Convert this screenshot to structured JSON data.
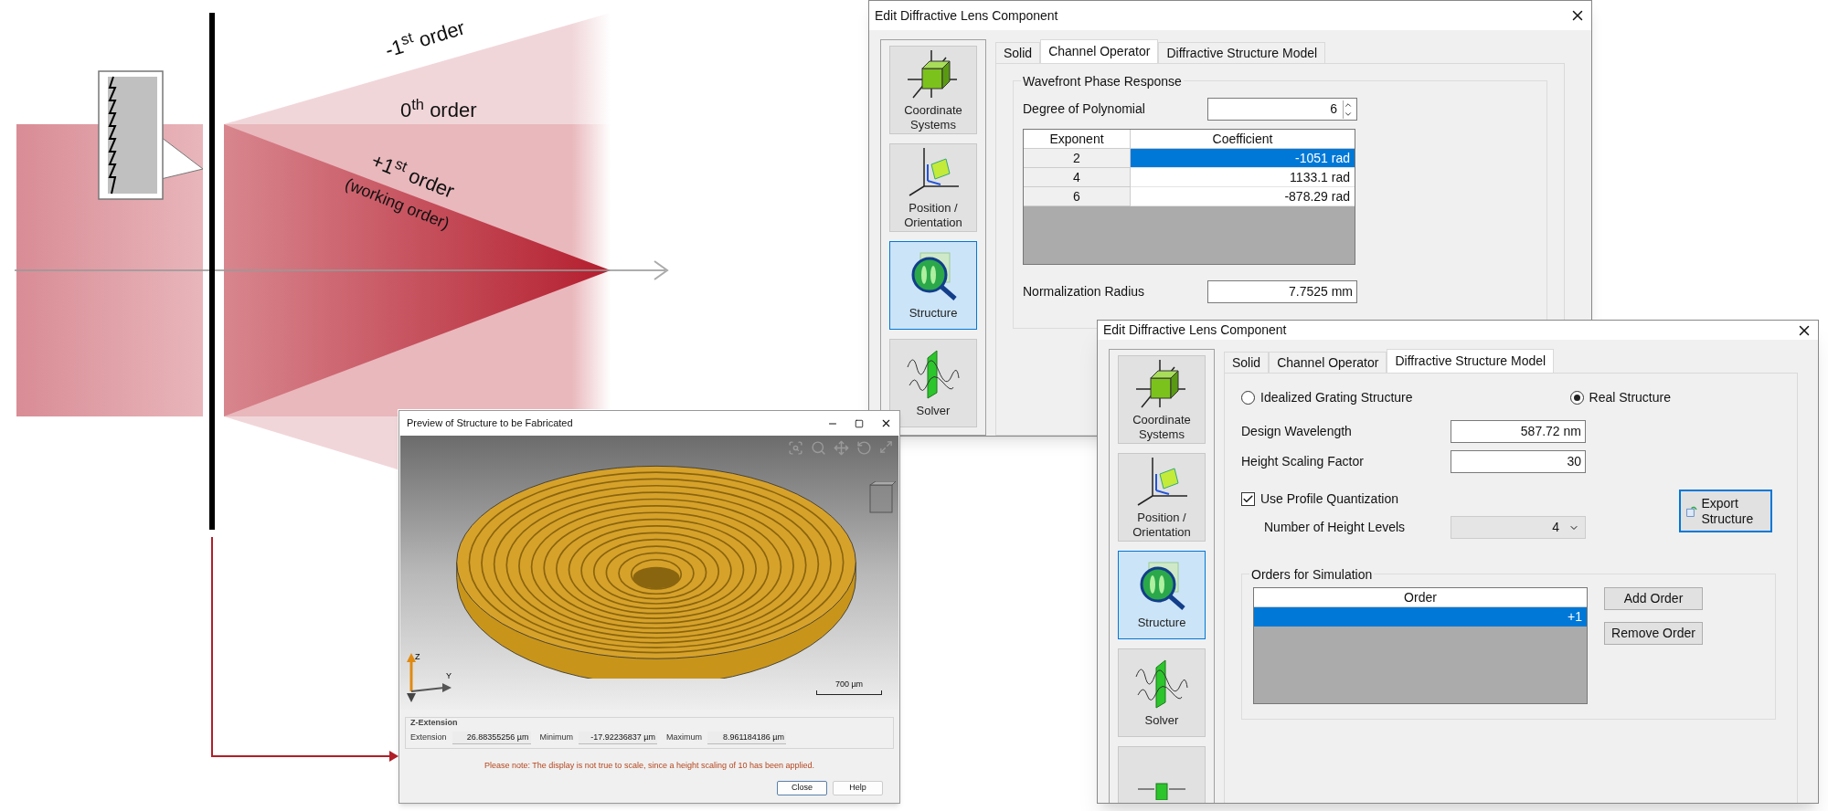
{
  "diagram": {
    "labels": [
      {
        "text": "-1$^{st}$ order"
      },
      {
        "text": "0$^{th}$ order"
      },
      {
        "text": "+1$^{st}$ order"
      },
      {
        "text": "(working order)"
      }
    ]
  },
  "preview_window": {
    "title": "Preview of Structure to be Fabricated",
    "axis_labels": [
      "Z",
      "Y"
    ],
    "scale_bar": "700 µm",
    "z_extension": {
      "title": "Z-Extension",
      "fields": [
        {
          "label": "Extension",
          "value": "26.88355256 µm"
        },
        {
          "label": "Minimum",
          "value": "-17.92236837 µm"
        },
        {
          "label": "Maximum",
          "value": "8.961184186 µm"
        }
      ]
    },
    "note": "Please note: The display is not true to scale, since a height scaling of 10 has been applied.",
    "buttons": [
      "Close",
      "Help"
    ]
  },
  "channel_dialog": {
    "title": "Edit Diffractive Lens Component",
    "sidebar": [
      {
        "kind": "coordinate",
        "label": "Coordinate Systems",
        "selected": false
      },
      {
        "kind": "position",
        "label": "Position / Orientation",
        "selected": false
      },
      {
        "kind": "structure",
        "label": "Structure",
        "selected": true
      },
      {
        "kind": "solver",
        "label": "Solver",
        "selected": false
      }
    ],
    "tabs": [
      {
        "label": "Solid",
        "selected": false
      },
      {
        "label": "Channel Operator",
        "selected": true
      },
      {
        "label": "Diffractive Structure Model",
        "selected": false
      }
    ],
    "group_title": "Wavefront Phase Response",
    "degree": {
      "label": "Degree of Polynomial",
      "value": "6"
    },
    "table": {
      "columns": [
        "Exponent",
        "Coefficient"
      ],
      "rows": [
        {
          "exponent": "2",
          "coefficient": "-1051 rad",
          "selected": true
        },
        {
          "exponent": "4",
          "coefficient": "1133.1 rad",
          "selected": false
        },
        {
          "exponent": "6",
          "coefficient": "-878.29 rad",
          "selected": false
        }
      ]
    },
    "normalization": {
      "label": "Normalization Radius",
      "value": "7.7525 mm"
    }
  },
  "structure_dialog": {
    "title": "Edit Diffractive Lens Component",
    "sidebar": [
      {
        "kind": "coordinate",
        "label": "Coordinate Systems",
        "selected": false
      },
      {
        "kind": "position",
        "label": "Position / Orientation",
        "selected": false
      },
      {
        "kind": "structure",
        "label": "Structure",
        "selected": true
      },
      {
        "kind": "solver",
        "label": "Solver",
        "selected": false
      },
      {
        "kind": "port",
        "selected": false
      }
    ],
    "tabs": [
      {
        "label": "Solid",
        "selected": false
      },
      {
        "label": "Channel Operator",
        "selected": false
      },
      {
        "label": "Diffractive Structure Model",
        "selected": true
      }
    ],
    "radios": [
      {
        "label": "Idealized Grating Structure",
        "selected": false
      },
      {
        "label": "Real Structure",
        "selected": true
      }
    ],
    "fields": [
      {
        "label": "Design Wavelength",
        "value": "587.72 nm"
      },
      {
        "label": "Height Scaling Factor",
        "value": "30"
      }
    ],
    "checkbox": {
      "label": "Use Profile Quantization",
      "checked": true
    },
    "levels": {
      "label": "Number of Height Levels",
      "value": "4"
    },
    "export_button": "Export Structure",
    "orders": {
      "title": "Orders for Simulation",
      "column": "Order",
      "rows": [
        {
          "value": "+1",
          "selected": true
        }
      ]
    },
    "buttons": [
      "Add Order",
      "Remove Order"
    ]
  }
}
